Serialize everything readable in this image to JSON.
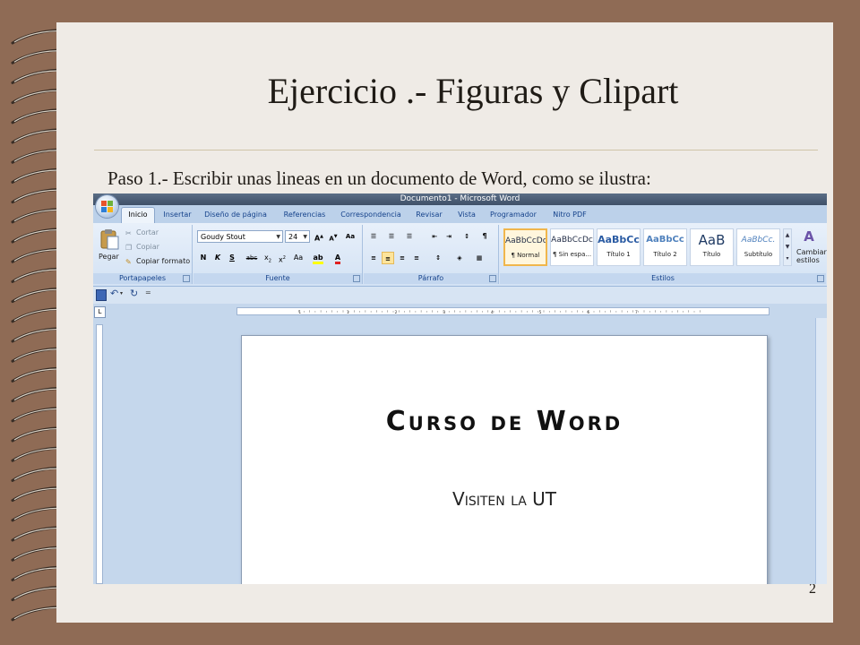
{
  "slide": {
    "title": "Ejercicio .- Figuras y Clipart",
    "caption": "Paso 1.- Escribir unas lineas en un documento de Word, como se ilustra:",
    "page_number": "2"
  },
  "word": {
    "window_title": "Documento1 - Microsoft Word",
    "tabs": [
      "Inicio",
      "Insertar",
      "Diseño de página",
      "Referencias",
      "Correspondencia",
      "Revisar",
      "Vista",
      "Programador",
      "Nitro PDF"
    ],
    "active_tab": "Inicio",
    "clipboard": {
      "paste": "Pegar",
      "cut": "Cortar",
      "copy": "Copiar",
      "format_painter": "Copiar formato",
      "label": "Portapapeles"
    },
    "font": {
      "name": "Goudy Stout",
      "size": "24",
      "label": "Fuente"
    },
    "paragraph": {
      "label": "Párrafo"
    },
    "styles": {
      "items": [
        {
          "sample": "AaBbCcDc",
          "name": "¶ Normal"
        },
        {
          "sample": "AaBbCcDc",
          "name": "¶ Sin espa..."
        },
        {
          "sample": "AaBbCc",
          "name": "Título 1"
        },
        {
          "sample": "AaBbCc",
          "name": "Título 2"
        },
        {
          "sample": "AaB",
          "name": "Título"
        },
        {
          "sample": "AaBbCc.",
          "name": "Subtítulo"
        }
      ],
      "change": "Cambiar estilos",
      "label": "Estilos"
    },
    "ruler_numbers": [
      "1",
      "1",
      "2",
      "3",
      "4",
      "5",
      "6",
      "7"
    ],
    "document": {
      "line1": "Curso de Word",
      "line2": "Visiten la UT"
    }
  },
  "colors": {
    "frame": "#8f6b55",
    "paper": "#efebe6",
    "ribbon": "#d3e2f4",
    "ribbon_label": "#15428b"
  }
}
